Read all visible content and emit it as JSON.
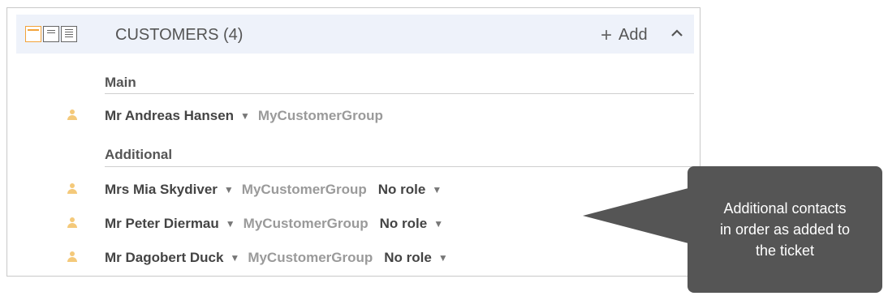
{
  "panel": {
    "title": "CUSTOMERS (4)",
    "add_label": "Add",
    "add_icon": "plus-icon",
    "collapse_icon": "chevron-up-icon",
    "layout_icons": [
      "compact-view-icon",
      "summary-view-icon",
      "full-view-icon"
    ]
  },
  "sections": {
    "main": "Main",
    "additional": "Additional"
  },
  "main_contact": {
    "name": "Mr Andreas Hansen",
    "group": "MyCustomerGroup"
  },
  "additional_contacts": [
    {
      "name": "Mrs Mia Skydiver",
      "group": "MyCustomerGroup",
      "role": "No role"
    },
    {
      "name": "Mr Peter Diermau",
      "group": "MyCustomerGroup",
      "role": "No role"
    },
    {
      "name": "Mr Dagobert Duck",
      "group": "MyCustomerGroup",
      "role": "No role"
    }
  ],
  "callout": {
    "line1": "Additional contacts",
    "line2": "in order as added to",
    "line3": "the ticket"
  },
  "colors": {
    "accent": "#f2a33a",
    "header_bg": "#eef2fa",
    "callout_bg": "#555555"
  }
}
